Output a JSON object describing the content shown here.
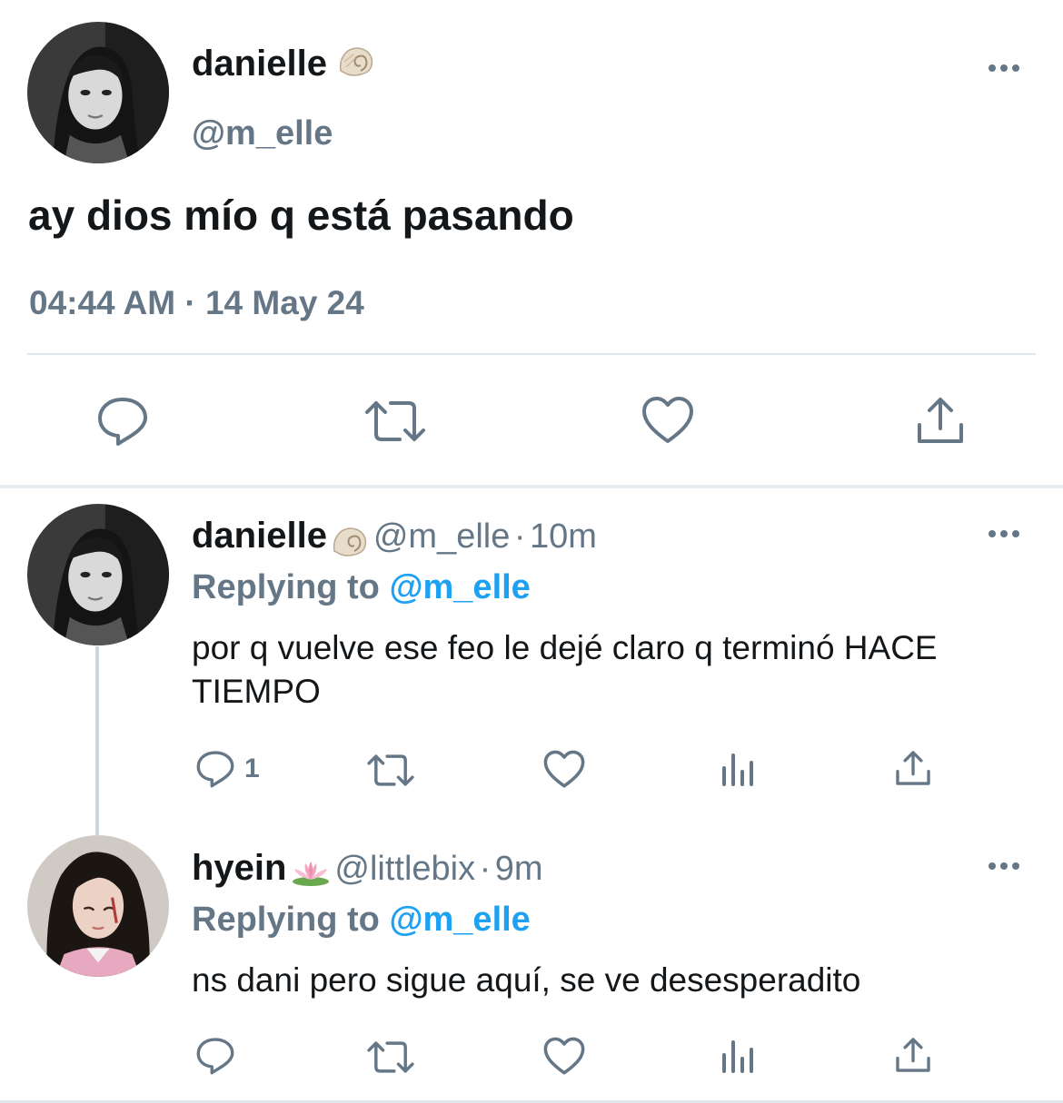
{
  "main_tweet": {
    "author_name": "danielle",
    "author_emoji": "spiral-shell-emoji",
    "handle": "@m_elle",
    "text": "ay dios mío q está pasando",
    "time": "04:44 AM",
    "separator": "·",
    "date": "14 May 24"
  },
  "replies": [
    {
      "author_name": "danielle",
      "author_emoji": "spiral-shell-emoji",
      "handle": "@m_elle",
      "separator": "·",
      "age": "10m",
      "replying_prefix": "Replying to",
      "replying_to": "@m_elle",
      "text": "por q vuelve ese feo le dejé claro q terminó HACE TIEMPO",
      "reply_count": "1"
    },
    {
      "author_name": "hyein",
      "author_emoji": "lotus-emoji",
      "handle": "@littlebix",
      "separator": "·",
      "age": "9m",
      "replying_prefix": "Replying to",
      "replying_to": "@m_elle",
      "text": "ns dani pero sigue aquí, se ve desesperadito"
    }
  ],
  "colors": {
    "text": "#14171a",
    "secondary": "#657786",
    "link": "#1da1f2",
    "divider": "#e1e8ed",
    "icon": "#657786"
  }
}
